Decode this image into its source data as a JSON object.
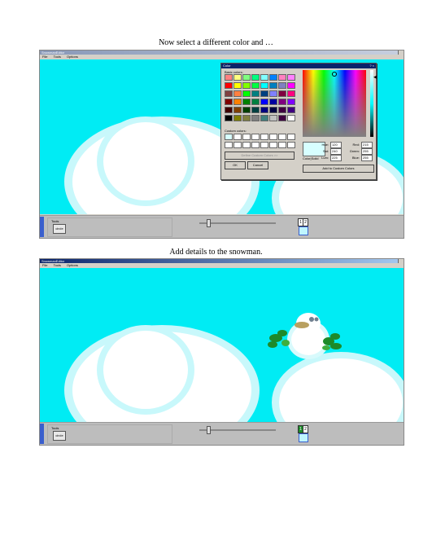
{
  "captions": {
    "top": "Now select a different color and …",
    "bottom": "Add details to the snowman."
  },
  "screenshot1": {
    "window_title": "SnowmanEditor",
    "menu": [
      "File",
      "Tools",
      "Options"
    ],
    "tools_label": "Tools",
    "tool_button": "circle",
    "layers": [
      "1",
      "2"
    ],
    "color_dialog": {
      "title": "Color",
      "title_buttons": "? ×",
      "basic_colors_label": "Basic colors:",
      "custom_colors_label": "Custom colors:",
      "define_custom_button": "Define Custom Colors >>",
      "ok_button": "OK",
      "cancel_button": "Cancel",
      "color_solid_label": "Color|Solid",
      "add_custom_button": "Add to Custom Colors",
      "hue_label": "Hue:",
      "hue": "120",
      "sat_label": "Sat:",
      "sat": "240",
      "lum_label": "Lum:",
      "lum": "225",
      "red_label": "Red:",
      "red": "215",
      "green_label": "Green:",
      "green": "255",
      "blue_label": "Blue:",
      "blue": "255",
      "selected_color": "#d7ffff",
      "basic_colors": [
        "#ff8080",
        "#ffff80",
        "#80ff80",
        "#00ff80",
        "#80ffff",
        "#0080ff",
        "#ff80c0",
        "#ff80ff",
        "#ff0000",
        "#ffff00",
        "#80ff00",
        "#00ff40",
        "#00ffff",
        "#0080c0",
        "#8080c0",
        "#ff00ff",
        "#804040",
        "#ff8040",
        "#00ff00",
        "#008080",
        "#004080",
        "#8080ff",
        "#800040",
        "#ff0080",
        "#800000",
        "#ff8000",
        "#008000",
        "#008040",
        "#0000ff",
        "#0000a0",
        "#800080",
        "#8000ff",
        "#400000",
        "#804000",
        "#004000",
        "#004040",
        "#000080",
        "#000040",
        "#400040",
        "#400080",
        "#000000",
        "#808000",
        "#808040",
        "#808080",
        "#408080",
        "#c0c0c0",
        "#400040",
        "#ffffff"
      ]
    }
  },
  "screenshot2": {
    "window_title": "SnowmanEditor",
    "menu": [
      "File",
      "Tools",
      "Options"
    ],
    "tools_label": "Tools",
    "tool_button": "circle",
    "layers": [
      "1",
      "2"
    ]
  },
  "colors": {
    "sky": "#00ecf4",
    "cloud": "#ffffff",
    "glow": "#c8f8fb",
    "leaves": "#1d8a2a",
    "beak": "#b8a060"
  }
}
